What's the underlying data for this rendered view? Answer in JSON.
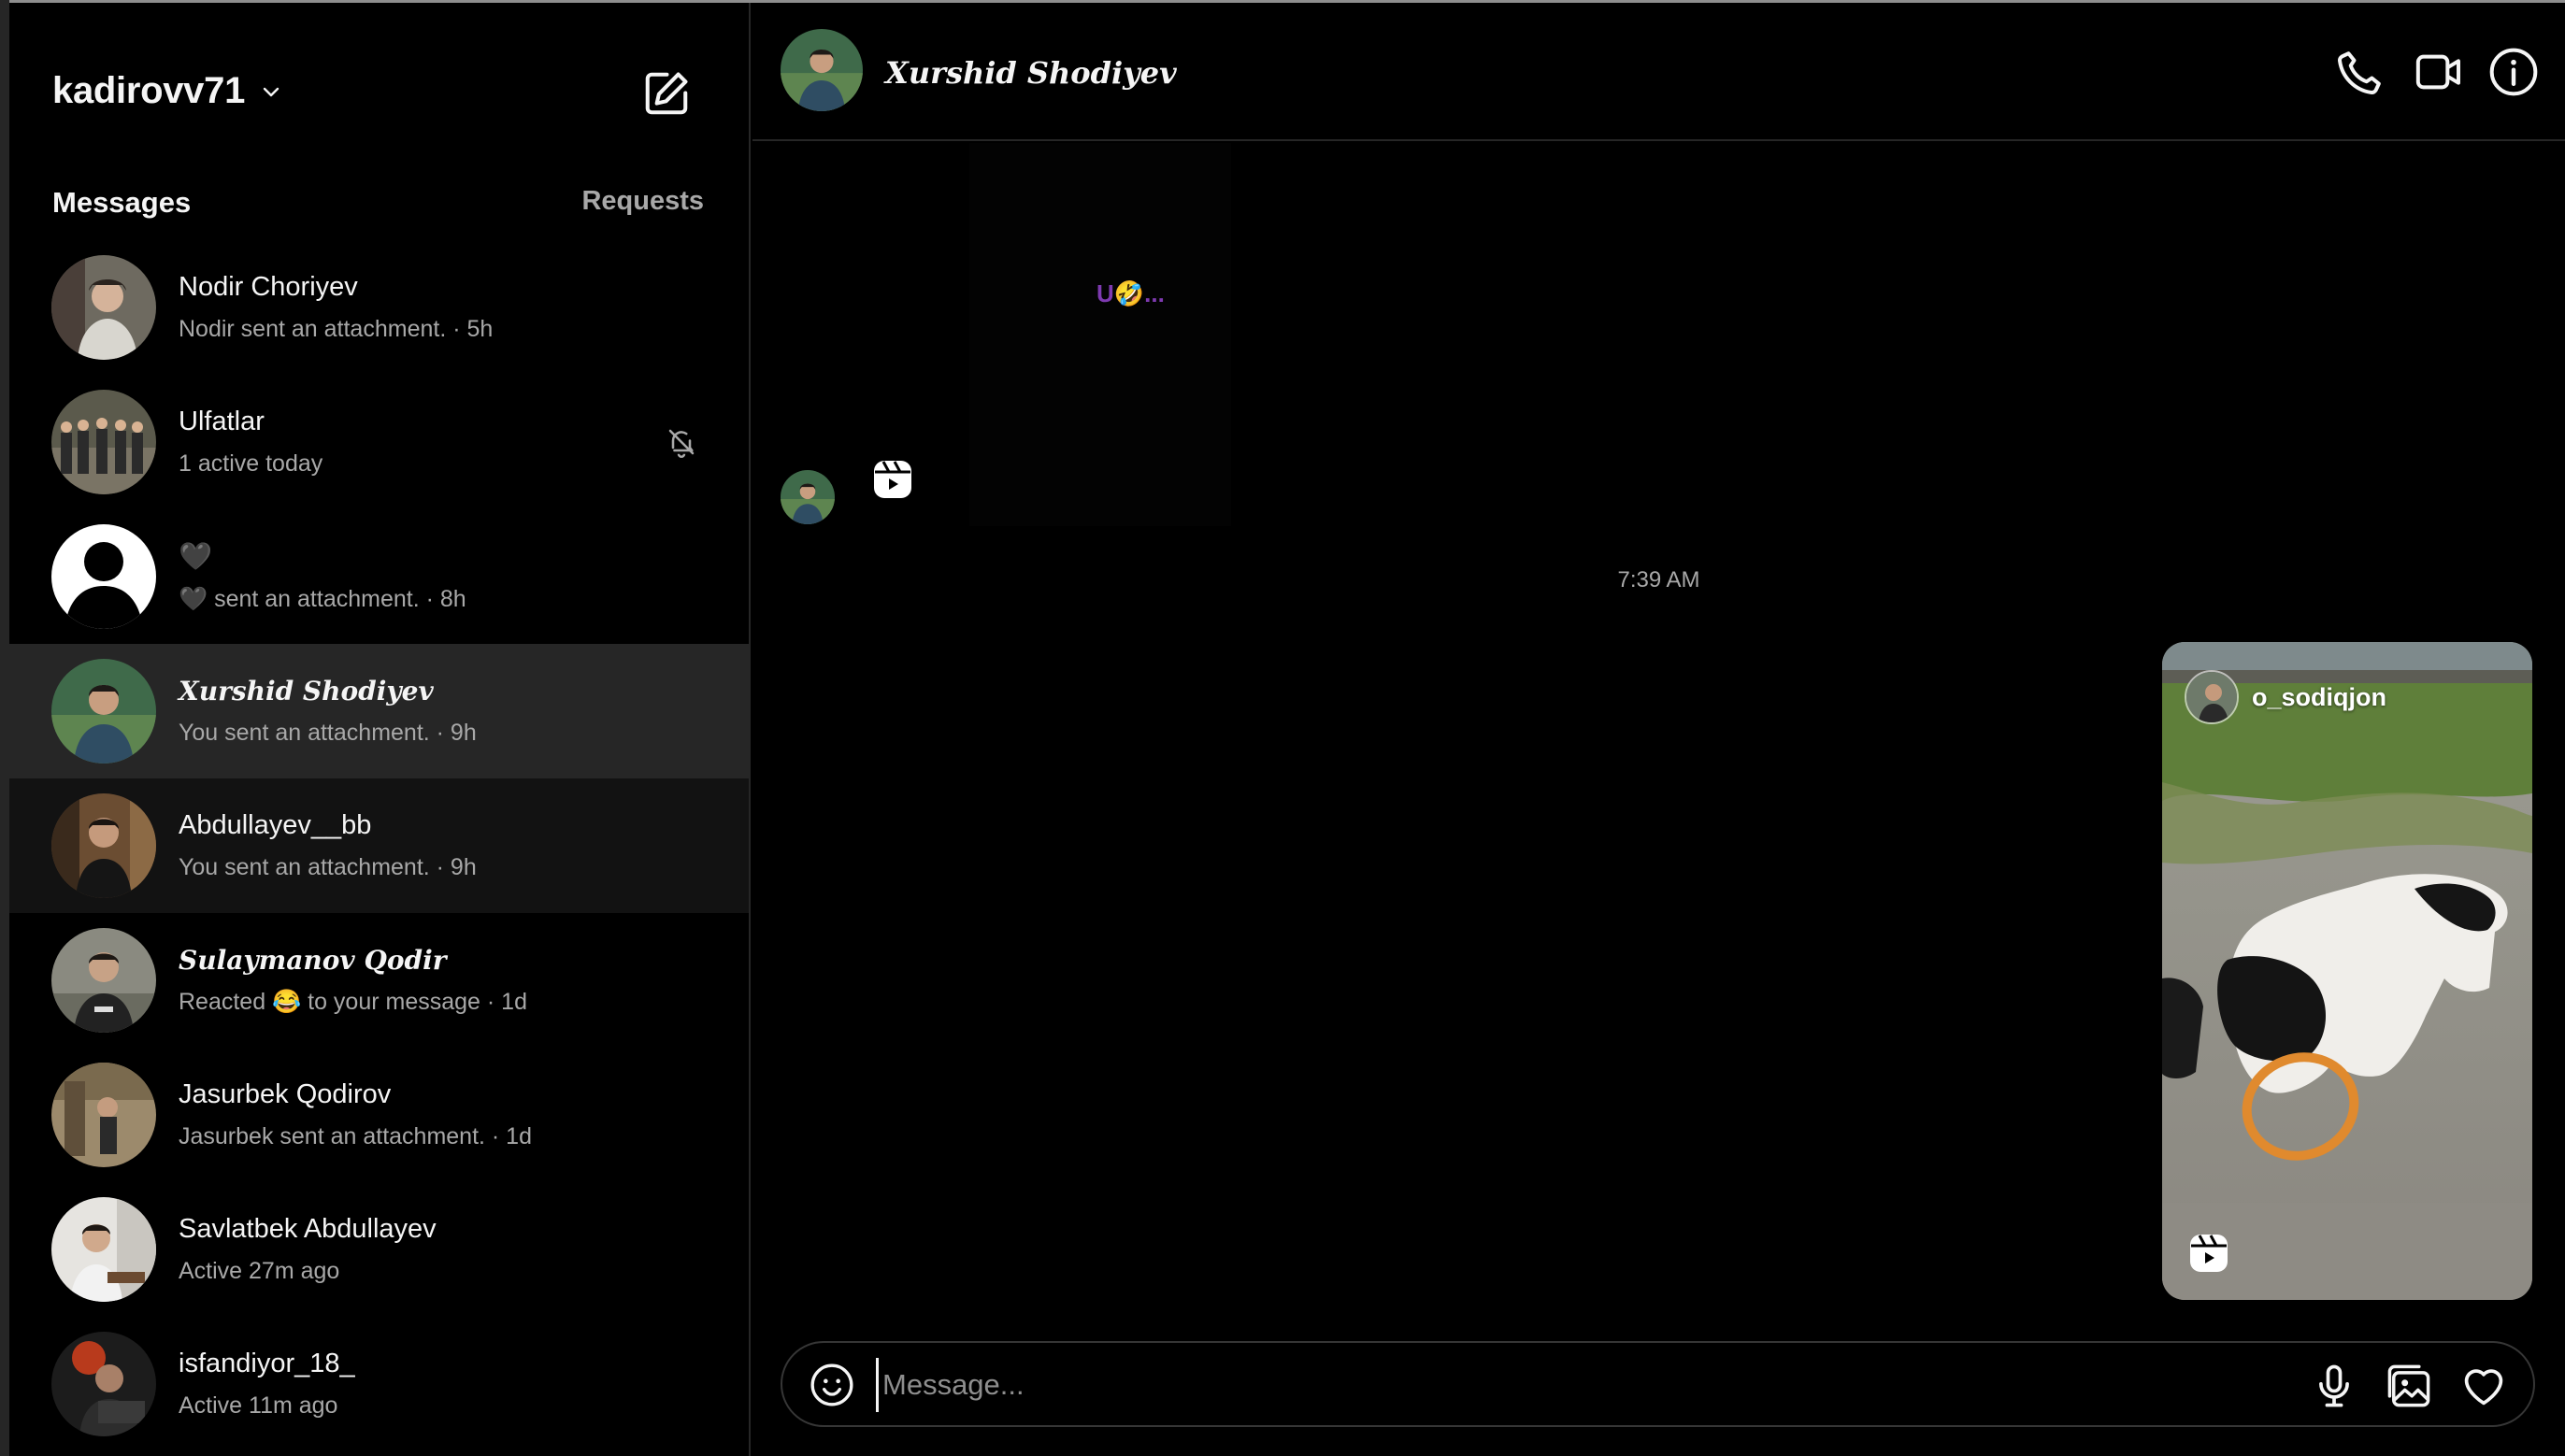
{
  "account": {
    "username": "kadirovv71"
  },
  "sidebar": {
    "messages_label": "Messages",
    "requests_label": "Requests",
    "conversations": [
      {
        "name": "Nodir Choriyev",
        "subtitle": "Nodir sent an attachment. · 5h",
        "style": "plain"
      },
      {
        "name": "Ulfatlar",
        "subtitle": "1 active today",
        "style": "plain",
        "muted": true
      },
      {
        "name": "🖤",
        "subtitle": "🖤 sent an attachment. · 8h",
        "style": "plain"
      },
      {
        "name": "𝑿𝒖𝒓𝒔𝒉𝒊𝒅 𝑺𝒉𝒐𝒅𝒊𝒚𝒆𝒗",
        "subtitle": "You sent an attachment. · 9h",
        "style": "script",
        "selected": true
      },
      {
        "name": "Abdullayev__bb",
        "subtitle": "You sent an attachment. · 9h",
        "style": "plain"
      },
      {
        "name": "𝑺𝒖𝒍𝒂𝒚𝒎𝒂𝒏𝒐𝒗 𝑸𝒐𝒅𝒊𝒓",
        "subtitle": "Reacted 😂 to your message · 1d",
        "style": "script"
      },
      {
        "name": "Jasurbek Qodirov",
        "subtitle": "Jasurbek sent an attachment. · 1d",
        "style": "plain"
      },
      {
        "name": "Savlatbek Abdullayev",
        "subtitle": "Active 27m ago",
        "style": "plain"
      },
      {
        "name": "isfandiyor_18_",
        "subtitle": "Active 11m ago",
        "style": "plain"
      }
    ]
  },
  "chat": {
    "title": "𝑿𝒖𝒓𝒔𝒉𝒊𝒅 𝑺𝒉𝒐𝒅𝒊𝒚𝒆𝒗",
    "reel_caption": "U🤣...",
    "timestamp": "7:39 AM",
    "shared_reel": {
      "username": "o_sodiqjon"
    }
  },
  "composer": {
    "placeholder": "Message..."
  },
  "icons": {
    "header": [
      "phone-icon",
      "video-camera-icon",
      "info-icon"
    ],
    "composer": [
      "emoji-icon",
      "microphone-icon",
      "image-icon",
      "heart-icon"
    ]
  },
  "colors": {
    "background": "#000000",
    "selected_row": "#262626",
    "secondary_text": "#a8a8a8",
    "border": "#262626",
    "caption_purple": "#7e3ab0",
    "annotation_orange": "#e08a2e"
  }
}
